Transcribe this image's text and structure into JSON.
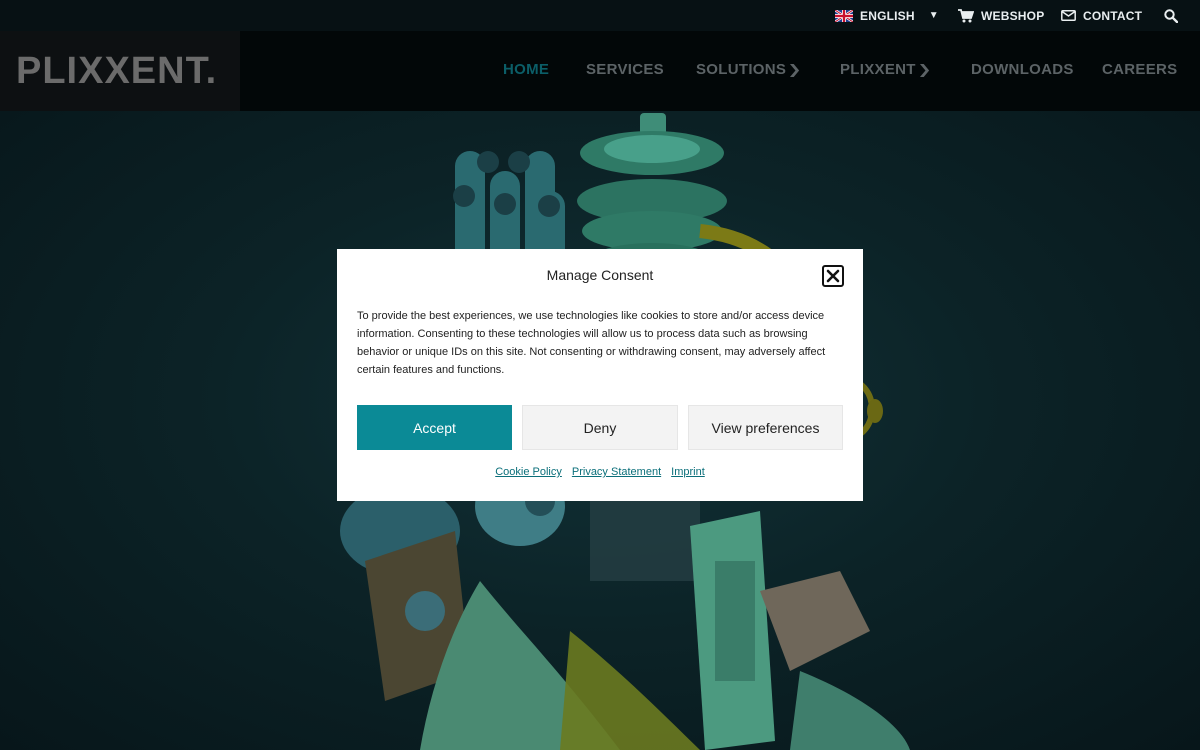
{
  "topbar": {
    "language": "ENGLISH",
    "webshop": "WEBSHOP",
    "contact": "CONTACT"
  },
  "header": {
    "logo": "PLIXXENT.",
    "nav": {
      "home": "HOME",
      "services": "SERVICES",
      "solutions": "SOLUTIONS",
      "plixxent": "PLIXXENT",
      "downloads": "DOWNLOADS",
      "careers": "CAREERS"
    },
    "active_item": "HOME"
  },
  "consent": {
    "title": "Manage Consent",
    "body": "To provide the best experiences, we use technologies like cookies to store and/or access device information. Consenting to these technologies will allow us to process data such as browsing behavior or unique IDs on this site. Not consenting or withdrawing consent, may adversely affect certain features and functions.",
    "accept": "Accept",
    "deny": "Deny",
    "view_preferences": "View preferences",
    "links": {
      "cookie_policy": "Cookie Policy",
      "privacy_statement": "Privacy Statement",
      "imprint": "Imprint"
    }
  },
  "colors": {
    "accent": "#0b8a96",
    "nav_active": "#0b5e68",
    "hero_bg": "#0c2327"
  }
}
